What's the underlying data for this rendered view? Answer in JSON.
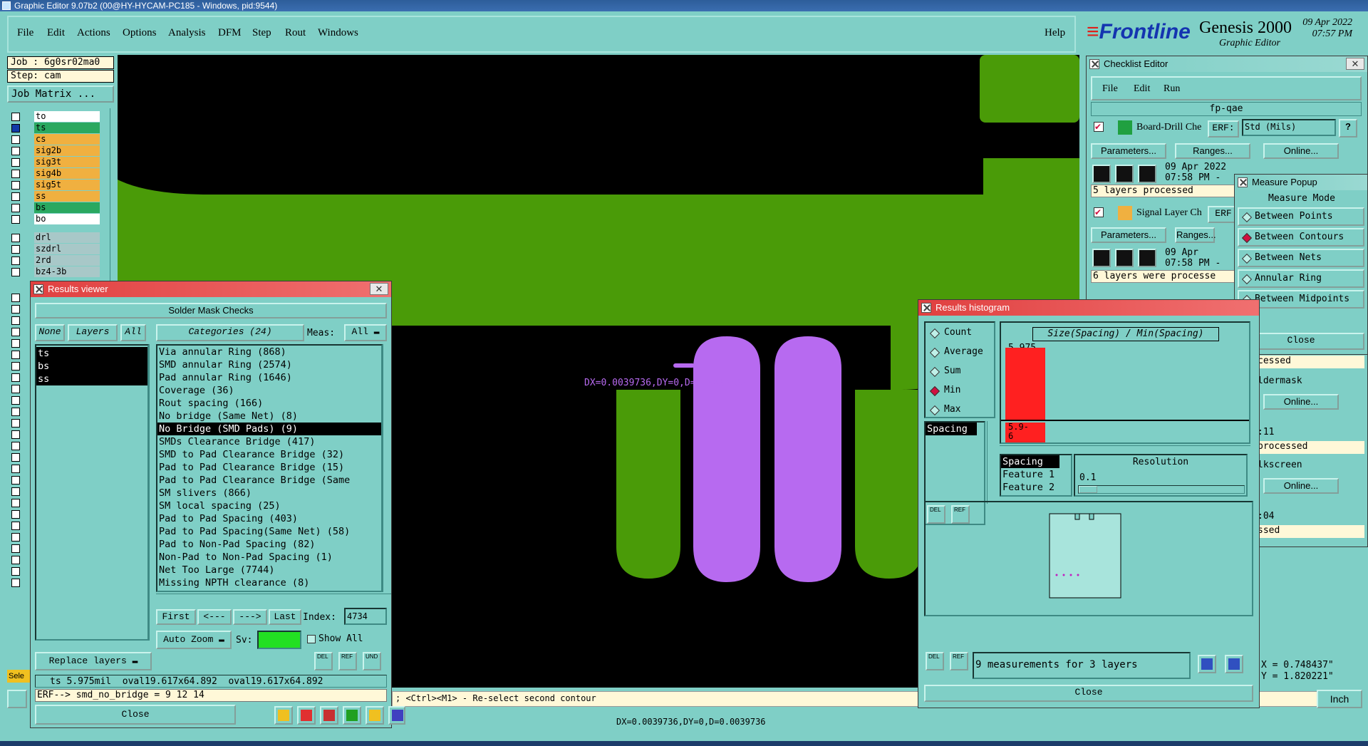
{
  "window": {
    "title": "Graphic Editor 9.07b2 (00@HY-HYCAM-PC185 - Windows, pid:9544)"
  },
  "menu": [
    "File",
    "Edit",
    "Actions",
    "Options",
    "Analysis",
    "DFM",
    "Step",
    "Rout",
    "Windows"
  ],
  "help_label": "Help",
  "logo": {
    "brand": "Frontline",
    "product": "Genesis 2000",
    "subtitle": "Graphic Editor",
    "date": "09 Apr 2022",
    "time": "07:57 PM"
  },
  "job": {
    "job_label": "Job : 6g0sr02ma0",
    "step_label": "Step: cam",
    "matrix_button": "Job Matrix ..."
  },
  "layers": [
    {
      "name": "to",
      "color": "w",
      "checked": false
    },
    {
      "name": "ts",
      "color": "g",
      "checked": true
    },
    {
      "name": "cs",
      "color": "o",
      "checked": false
    },
    {
      "name": "sig2b",
      "color": "o",
      "checked": false
    },
    {
      "name": "sig3t",
      "color": "o",
      "checked": false
    },
    {
      "name": "sig4b",
      "color": "o",
      "checked": false
    },
    {
      "name": "sig5t",
      "color": "o",
      "checked": false
    },
    {
      "name": "ss",
      "color": "o",
      "checked": false
    },
    {
      "name": "bs",
      "color": "g",
      "checked": false
    },
    {
      "name": "bo",
      "color": "b",
      "checked": false
    },
    {
      "name": "drl",
      "color": "s",
      "checked": false
    },
    {
      "name": "szdrl",
      "color": "s",
      "checked": false
    },
    {
      "name": "2rd",
      "color": "s",
      "checked": false
    },
    {
      "name": "bz4-3b",
      "color": "s",
      "checked": false
    }
  ],
  "canvas": {
    "measure_text": "DX=0.0039736,DY=0,D=0.0039736",
    "prompt": "; <Ctrl><M1> - Re-select second contour",
    "bottom_readout": "DX=0.0039736,DY=0,D=0.0039736",
    "coords": {
      "x": "X = 0.748437\"",
      "y": "Y = 1.820221\""
    },
    "units_button": "Inch",
    "sel_label": "Sele"
  },
  "results_viewer": {
    "title": "Results viewer",
    "header": "Solder Mask Checks",
    "none_btn": "None",
    "layers_btn": "Layers",
    "all_btn": "All",
    "categories_btn": "Categories (24)",
    "meas_label": "Meas:",
    "meas_value": "All",
    "layer_list": [
      "ts",
      "bs",
      "ss"
    ],
    "categories": [
      "Via annular Ring (868)",
      "SMD annular Ring (2574)",
      "Pad annular Ring (1646)",
      "Coverage (36)",
      "Rout spacing (166)",
      "No bridge (Same Net) (8)",
      "No Bridge (SMD Pads) (9)",
      "SMDs Clearance Bridge (417)",
      "SMD to Pad Clearance Bridge (32)",
      "Pad to Pad Clearance Bridge (15)",
      "Pad to Pad Clearance Bridge (Same",
      "SM slivers (866)",
      "SM local spacing (25)",
      "Pad to Pad Spacing (403)",
      "Pad to Pad Spacing(Same Net) (58)",
      "Pad to Non-Pad Spacing (82)",
      "Non-Pad to Non-Pad Spacing (1)",
      "Net Too Large (7744)",
      "Missing NPTH clearance (8)"
    ],
    "selected_index": 6,
    "first_btn": "First",
    "prev_btn": "<---",
    "next_btn": "--->",
    "last_btn": "Last",
    "index_label": "Index:",
    "index_value": "4734",
    "auto_zoom": "Auto Zoom",
    "sv_label": "Sv:",
    "show_all": "Show All",
    "replace_layers": "Replace layers",
    "icon_del": "DEL",
    "icon_ref": "REF",
    "icon_und": "UND",
    "status_line": "ts 5.975mil  oval19.617x64.892  oval19.617x64.892",
    "erf_line": "ERF--> smd_no_bridge = 9 12 14",
    "close_btn": "Close"
  },
  "checklist": {
    "title": "Checklist Editor",
    "menu": [
      "File",
      "Edit",
      "Run"
    ],
    "name": "fp-qae",
    "items": [
      {
        "name": "Board-Drill Che",
        "erf_label": "ERF:",
        "erf": "Std (Mils)",
        "date": "09 Apr 2022",
        "time": "07:58 PM -",
        "status": "5 layers processed"
      },
      {
        "name": "Signal Layer Ch",
        "erf_label": "ERF",
        "date": "09 Apr",
        "time": "07:58 PM -",
        "status": "6 layers were processe"
      }
    ],
    "params_btn": "Parameters...",
    "ranges_btn": "Ranges...",
    "online_btn": "Online...",
    "help": "?",
    "right_fragments": [
      "cessed",
      "ldermask",
      "Online...",
      ":11",
      "processed",
      "lkscreen",
      "Online...",
      ":04",
      "ssed"
    ]
  },
  "measure_popup": {
    "title": "Measure Popup",
    "mode_header": "Measure Mode",
    "modes": [
      "Between Points",
      "Between Contours",
      "Between Nets",
      "Annular Ring",
      "Between Midpoints"
    ],
    "selected": 1,
    "close_btn": "Close"
  },
  "histogram": {
    "title": "Results histogram",
    "stats": [
      "Count",
      "Average",
      "Sum",
      "Min",
      "Max"
    ],
    "selected_stat": 3,
    "list_item": "Spacing",
    "chart_title": "Size(Spacing) / Min(Spacing)",
    "bar_value": "5.975",
    "bar_label": "5.9-\n6",
    "bar_fill": 0.92,
    "attr_items": [
      "Spacing",
      "Feature 1",
      "Feature 2"
    ],
    "resolution_label": "Resolution",
    "resolution_value": "0.1",
    "summary": "9 measurements for 3 layers",
    "close_btn": "Close",
    "icon_del": "DEL",
    "icon_ref": "REF"
  },
  "colors": {
    "board": "#4a9b08",
    "pads": "#b76af0",
    "panel": "#7fcfc6",
    "red": "#ff2020"
  }
}
